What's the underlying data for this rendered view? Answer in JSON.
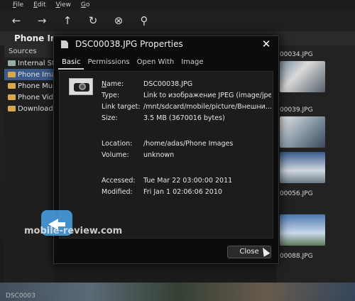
{
  "menubar": {
    "items": [
      "File",
      "Edit",
      "View",
      "Go"
    ]
  },
  "toolbar": {
    "icons": [
      "arrow-left-icon",
      "arrow-right-icon",
      "arrow-up-icon",
      "refresh-icon",
      "stop-icon",
      "search-icon"
    ]
  },
  "location": {
    "title": "Phone Images"
  },
  "sidebar": {
    "header": "Sources",
    "items": [
      {
        "label": "Internal Sto",
        "icon": "drive-icon"
      },
      {
        "label": "Phone Ima",
        "icon": "folder-icon",
        "active": true
      },
      {
        "label": "Phone Mus",
        "icon": "folder-icon"
      },
      {
        "label": "Phone Vide",
        "icon": "folder-icon"
      },
      {
        "label": "Downloads",
        "icon": "folder-icon"
      }
    ]
  },
  "files": [
    {
      "name": "00034.JPG"
    },
    {
      "name": "00039.JPG"
    },
    {
      "name": "00056.JPG"
    },
    {
      "name": "00088.JPG"
    }
  ],
  "dialog": {
    "title": "DSC00038.JPG Properties",
    "tabs": [
      "Basic",
      "Permissions",
      "Open With",
      "Image"
    ],
    "active_tab": "Basic",
    "props": {
      "name": {
        "label": "Name:",
        "value": "DSC00038.JPG"
      },
      "type": {
        "label": "Type:",
        "value": "Link to изображение JPEG (image/jpeg)"
      },
      "link_target": {
        "label": "Link target:",
        "value": "/mnt/sdcard/mobile/picture/Внешни..."
      },
      "size": {
        "label": "Size:",
        "value": "3.5 MB (3670016 bytes)"
      },
      "location": {
        "label": "Location:",
        "value": "/home/adas/Phone Images"
      },
      "volume": {
        "label": "Volume:",
        "value": "unknown"
      },
      "accessed": {
        "label": "Accessed:",
        "value": "Tue Mar 22 03:00:00 2011"
      },
      "modified": {
        "label": "Modified:",
        "value": "Fri Jan  1 02:06:06 2010"
      }
    },
    "close_label": "Close"
  },
  "watermark": {
    "text": "mobile-review.com"
  },
  "bottom_strip": {
    "text": "DSC0003"
  }
}
